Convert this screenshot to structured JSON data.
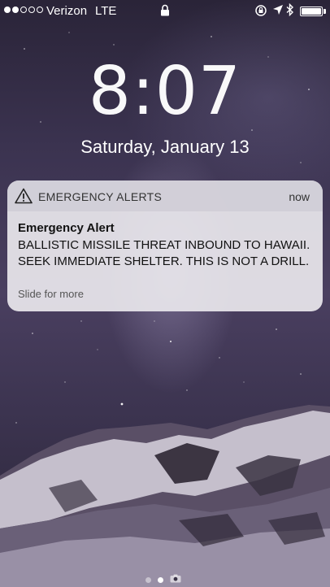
{
  "status_bar": {
    "signal_bars_filled": 2,
    "signal_bars_total": 5,
    "carrier": "Verizon",
    "network": "LTE",
    "icons": [
      "lock-icon",
      "rotation-lock-icon",
      "location-arrow-icon",
      "bluetooth-icon",
      "battery-icon"
    ],
    "battery_level": 1.0
  },
  "lock_screen": {
    "time": "8:07",
    "date": "Saturday, January 13"
  },
  "notification": {
    "app_name": "EMERGENCY ALERTS",
    "timestamp": "now",
    "icon": "warning-triangle-icon",
    "title": "Emergency Alert",
    "body": "BALLISTIC MISSILE THREAT INBOUND TO HAWAII. SEEK IMMEDIATE SHELTER. THIS IS NOT A DRILL.",
    "hint": "Slide for more"
  },
  "page_indicator": {
    "pages": 2,
    "active_index": 1,
    "extra_icon": "camera-icon"
  }
}
